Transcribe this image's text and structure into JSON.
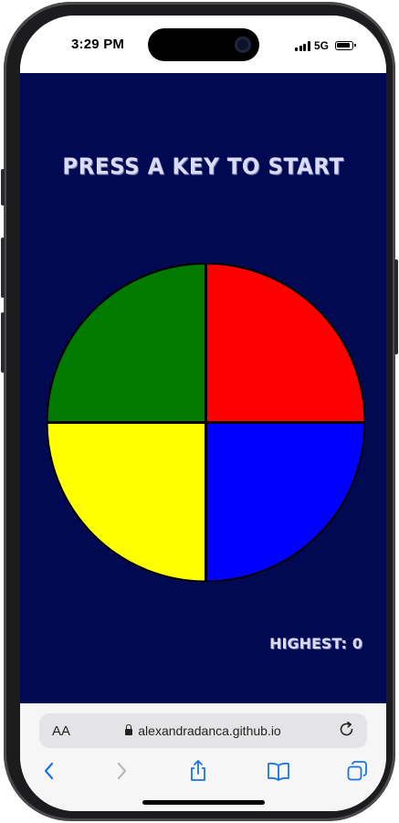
{
  "status_bar": {
    "time": "3:29 PM",
    "network": "5G",
    "icons": [
      "signal-icon",
      "battery-icon"
    ]
  },
  "game": {
    "title": "PRESS A KEY TO START",
    "highest_label": "HIGHEST:",
    "highest_value": "0",
    "background_color": "#020953",
    "buttons": [
      {
        "name": "green",
        "color": "#007a00"
      },
      {
        "name": "red",
        "color": "#ff0000"
      },
      {
        "name": "yellow",
        "color": "#ffff00"
      },
      {
        "name": "blue",
        "color": "#0000ff"
      }
    ]
  },
  "browser": {
    "text_size_label": "AA",
    "url": "alexandradanca.github.io",
    "toolbar_icons": [
      "back-icon",
      "forward-icon",
      "share-icon",
      "bookmarks-icon",
      "tabs-icon"
    ]
  }
}
